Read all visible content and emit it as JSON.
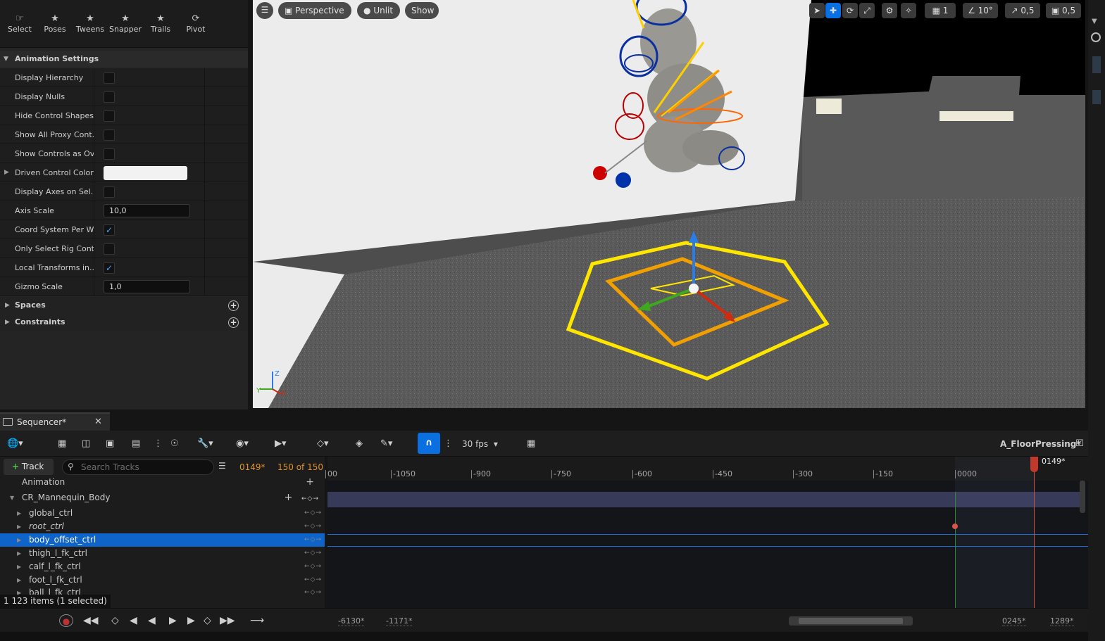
{
  "toolbar_modes": [
    {
      "label": "Select",
      "icon": "select-icon"
    },
    {
      "label": "Poses",
      "icon": "poses-icon"
    },
    {
      "label": "Tweens",
      "icon": "tweens-icon"
    },
    {
      "label": "Snapper",
      "icon": "snapper-icon"
    },
    {
      "label": "Trails",
      "icon": "trails-icon"
    },
    {
      "label": "Pivot",
      "icon": "pivot-icon"
    }
  ],
  "animation_settings": {
    "header": "Animation Settings",
    "rows": [
      {
        "label": "Display Hierarchy",
        "type": "check",
        "checked": false
      },
      {
        "label": "Display Nulls",
        "type": "check",
        "checked": false
      },
      {
        "label": "Hide Control Shapes",
        "type": "check",
        "checked": false
      },
      {
        "label": "Show All Proxy Cont...",
        "type": "check",
        "checked": false
      },
      {
        "label": "Show Controls as Ov...",
        "type": "check",
        "checked": false
      },
      {
        "label": "Driven Control Color",
        "type": "color",
        "value": "#f2f2f2"
      },
      {
        "label": "Display Axes on Sel...",
        "type": "check",
        "checked": false
      },
      {
        "label": "Axis Scale",
        "type": "number",
        "value": "10,0"
      },
      {
        "label": "Coord System Per W...",
        "type": "check",
        "checked": true
      },
      {
        "label": "Only Select Rig Cont...",
        "type": "check",
        "checked": false
      },
      {
        "label": "Local Transforms in...",
        "type": "check",
        "checked": true
      },
      {
        "label": "Gizmo Scale",
        "type": "number",
        "value": "1,0"
      }
    ]
  },
  "spaces_label": "Spaces",
  "constraints_label": "Constraints",
  "viewport": {
    "perspective": "Perspective",
    "unlit": "Unlit",
    "show": "Show",
    "grid_value": "1",
    "angle_value": "10°",
    "scale_value": "0,5",
    "camera_value": "0,5"
  },
  "sequencer": {
    "tab_title": "Sequencer*",
    "fps": "30 fps",
    "asset_name": "A_FloorPressing*",
    "track_button": "Track",
    "search_placeholder": "Search Tracks",
    "current_frame": "0149*",
    "frame_range": "150 of 150",
    "playhead_label": "0149*",
    "tracks": [
      {
        "name": "Animation",
        "level": 0,
        "italic": false,
        "selected": false,
        "expander": false
      },
      {
        "name": "CR_Mannequin_Body",
        "level": 0,
        "italic": false,
        "selected": false,
        "expander": true
      },
      {
        "name": "global_ctrl",
        "level": 1,
        "italic": false,
        "selected": false,
        "expander": true
      },
      {
        "name": "root_ctrl",
        "level": 1,
        "italic": true,
        "selected": false,
        "expander": true
      },
      {
        "name": "body_offset_ctrl",
        "level": 1,
        "italic": false,
        "selected": true,
        "expander": true
      },
      {
        "name": "thigh_l_fk_ctrl",
        "level": 1,
        "italic": false,
        "selected": false,
        "expander": true
      },
      {
        "name": "calf_l_fk_ctrl",
        "level": 1,
        "italic": false,
        "selected": false,
        "expander": true
      },
      {
        "name": "foot_l_fk_ctrl",
        "level": 1,
        "italic": false,
        "selected": false,
        "expander": true
      },
      {
        "name": "ball_l_fk_ctrl",
        "level": 1,
        "italic": false,
        "selected": false,
        "expander": true
      }
    ],
    "items_status": "1 123 items (1 selected)",
    "ruler_ticks": [
      "00",
      "-1050",
      "-900",
      "-750",
      "-600",
      "-450",
      "-300",
      "-150",
      "0000"
    ],
    "view_start": "-6130*",
    "play_start": "-1171*",
    "play_end": "0245*",
    "view_end": "1289*"
  },
  "colors": {
    "accent": "#0a6fe0",
    "selection": "#0e64c8",
    "playhead": "#c0392b",
    "gizmo_yellow": "#ffe600",
    "gizmo_orange": "#f0a000"
  }
}
